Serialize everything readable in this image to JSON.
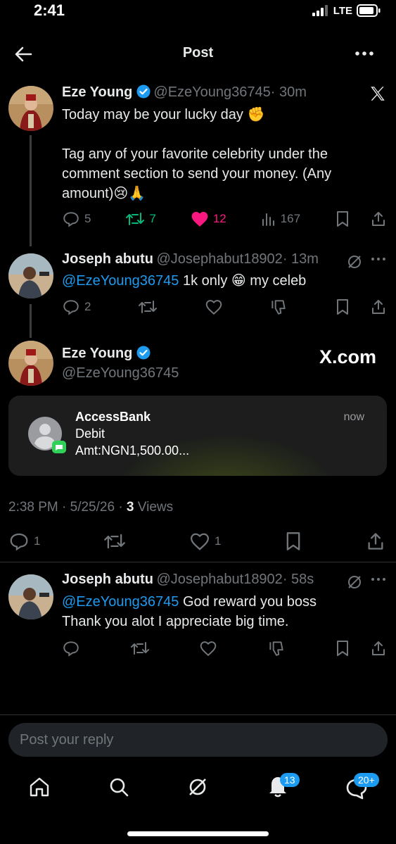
{
  "status_bar": {
    "time": "2:41",
    "network": "LTE"
  },
  "header": {
    "title": "Post"
  },
  "colors": {
    "accent": "#1d9bf0",
    "like": "#f91880",
    "repost": "#00ba7c",
    "muted": "#71767b"
  },
  "main_post": {
    "name": "Eze Young",
    "handle": "@EzeYoung36745",
    "time": "· 30m",
    "line1": "Today may be your lucky day ✊",
    "line2": "Tag any of your favorite celebrity under the",
    "line3": "comment section to send your money.  (Any",
    "line4": "amount)😢🙏",
    "replies": "5",
    "reposts": "7",
    "likes": "12",
    "views": "167"
  },
  "reply1": {
    "name": "Joseph abutu",
    "handle": "@Josephabut18902",
    "time": "· 13m",
    "mention": "@EzeYoung36745",
    "text": " 1k only 😁 my celeb",
    "replies": "2"
  },
  "focus_post": {
    "name": "Eze Young",
    "handle": "@EzeYoung36745",
    "watermark": "X.com",
    "notification": {
      "title": "AccessBank",
      "line1": "Debit",
      "line2": "Amt:NGN1,500.00...",
      "time": "now"
    },
    "timestamp": "2:38 PM · 5/25/26 · ",
    "views_count": "3",
    "views_label": " Views",
    "replies": "1",
    "likes": "1"
  },
  "reply2": {
    "name": "Joseph abutu",
    "handle": "@Josephabut18902",
    "time": "· 58s",
    "mention": "@EzeYoung36745",
    "text1": " God reward you boss",
    "text2": "Thank you alot I appreciate big time."
  },
  "composer": {
    "placeholder": "Post your reply"
  },
  "tab_bar": {
    "notifications_badge": "13",
    "messages_badge": "20+"
  }
}
